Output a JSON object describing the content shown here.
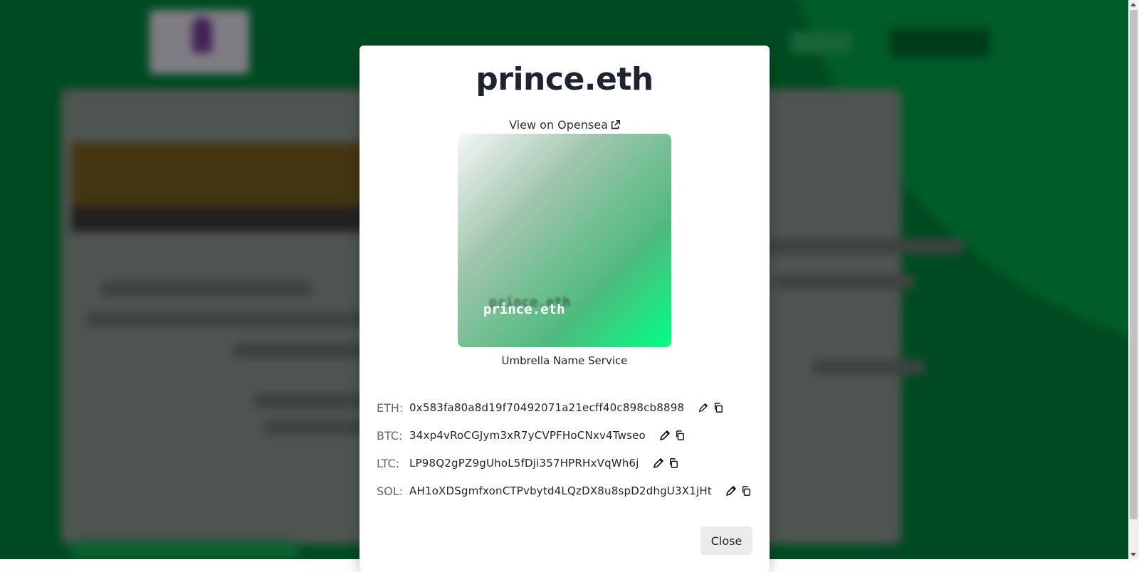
{
  "modal": {
    "title": "prince.eth",
    "opensea_link": "View on Opensea",
    "nft": {
      "text": "prince.eth",
      "caption": "Umbrella Name Service"
    },
    "addresses": [
      {
        "label": "ETH:",
        "value": "0x583fa80a8d19f70492071a21ecff40c898cb8898"
      },
      {
        "label": "BTC:",
        "value": "34xp4vRoCGJym3xR7yCVPFHoCNxv4Twseo"
      },
      {
        "label": "LTC:",
        "value": "LP98Q2gPZ9gUhoL5fDji357HPRHxVqWh6j"
      },
      {
        "label": "SOL:",
        "value": "AH1oXDSgmfxonCTPvbytd4LQzDX8u8spD2dhgU3X1jHt"
      }
    ],
    "close_label": "Close"
  },
  "icons": {
    "edit": "pencil-icon",
    "copy": "copy-icon",
    "external": "external-link-icon"
  },
  "colors": {
    "background_green": "#00893e",
    "nft_gradient_end": "#00ff84",
    "close_button_bg": "#e9ecef"
  }
}
